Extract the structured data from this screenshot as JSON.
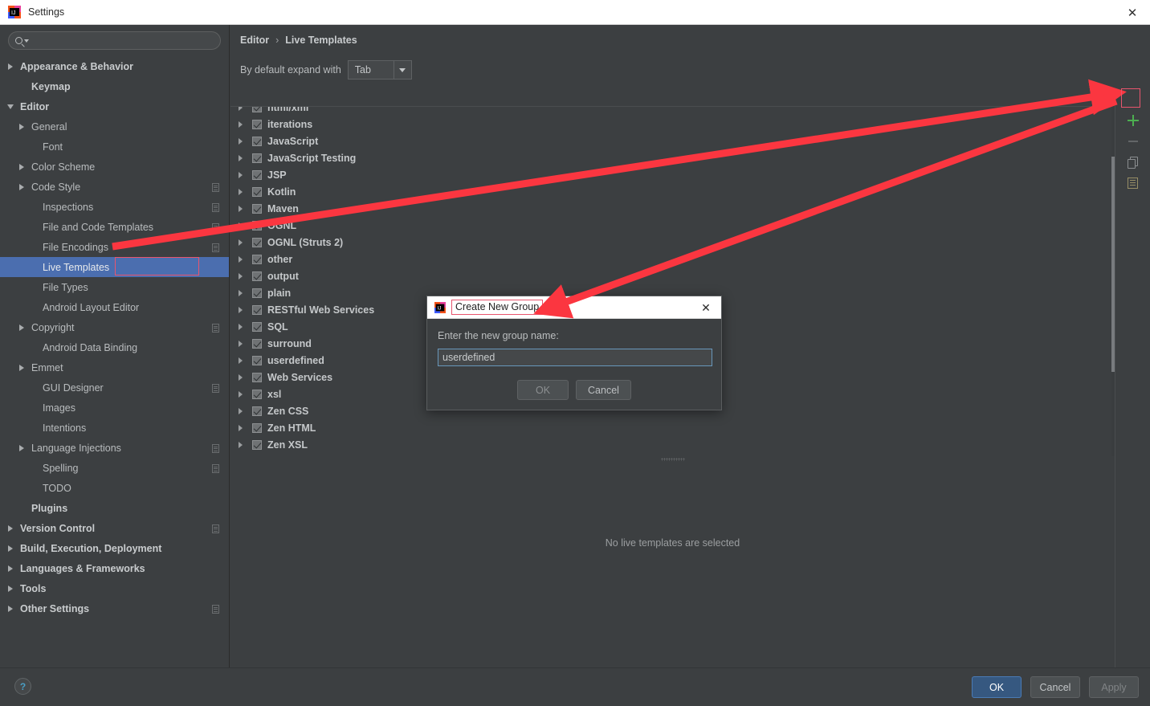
{
  "window": {
    "title": "Settings",
    "icon": "intellij-idea-icon",
    "close_label": "✕"
  },
  "sidebar": {
    "search": {
      "placeholder": "",
      "value": "",
      "icon": "search-icon"
    },
    "items": [
      {
        "label": "Appearance & Behavior",
        "arrow": "right",
        "indent": 0,
        "bold": true,
        "cfg": false,
        "selected": false
      },
      {
        "label": "Keymap",
        "arrow": "none",
        "indent": 1,
        "bold": true,
        "cfg": false,
        "selected": false
      },
      {
        "label": "Editor",
        "arrow": "down",
        "indent": 0,
        "bold": true,
        "cfg": false,
        "selected": false
      },
      {
        "label": "General",
        "arrow": "right",
        "indent": 1,
        "bold": false,
        "cfg": false,
        "selected": false
      },
      {
        "label": "Font",
        "arrow": "none",
        "indent": 2,
        "bold": false,
        "cfg": false,
        "selected": false
      },
      {
        "label": "Color Scheme",
        "arrow": "right",
        "indent": 1,
        "bold": false,
        "cfg": false,
        "selected": false
      },
      {
        "label": "Code Style",
        "arrow": "right",
        "indent": 1,
        "bold": false,
        "cfg": true,
        "selected": false
      },
      {
        "label": "Inspections",
        "arrow": "none",
        "indent": 2,
        "bold": false,
        "cfg": true,
        "selected": false
      },
      {
        "label": "File and Code Templates",
        "arrow": "none",
        "indent": 2,
        "bold": false,
        "cfg": true,
        "selected": false
      },
      {
        "label": "File Encodings",
        "arrow": "none",
        "indent": 2,
        "bold": false,
        "cfg": true,
        "selected": false
      },
      {
        "label": "Live Templates",
        "arrow": "none",
        "indent": 2,
        "bold": false,
        "cfg": false,
        "selected": true
      },
      {
        "label": "File Types",
        "arrow": "none",
        "indent": 2,
        "bold": false,
        "cfg": false,
        "selected": false
      },
      {
        "label": "Android Layout Editor",
        "arrow": "none",
        "indent": 2,
        "bold": false,
        "cfg": false,
        "selected": false
      },
      {
        "label": "Copyright",
        "arrow": "right",
        "indent": 1,
        "bold": false,
        "cfg": true,
        "selected": false
      },
      {
        "label": "Android Data Binding",
        "arrow": "none",
        "indent": 2,
        "bold": false,
        "cfg": false,
        "selected": false
      },
      {
        "label": "Emmet",
        "arrow": "right",
        "indent": 1,
        "bold": false,
        "cfg": false,
        "selected": false
      },
      {
        "label": "GUI Designer",
        "arrow": "none",
        "indent": 2,
        "bold": false,
        "cfg": true,
        "selected": false
      },
      {
        "label": "Images",
        "arrow": "none",
        "indent": 2,
        "bold": false,
        "cfg": false,
        "selected": false
      },
      {
        "label": "Intentions",
        "arrow": "none",
        "indent": 2,
        "bold": false,
        "cfg": false,
        "selected": false
      },
      {
        "label": "Language Injections",
        "arrow": "right",
        "indent": 1,
        "bold": false,
        "cfg": true,
        "selected": false
      },
      {
        "label": "Spelling",
        "arrow": "none",
        "indent": 2,
        "bold": false,
        "cfg": true,
        "selected": false
      },
      {
        "label": "TODO",
        "arrow": "none",
        "indent": 2,
        "bold": false,
        "cfg": false,
        "selected": false
      },
      {
        "label": "Plugins",
        "arrow": "none",
        "indent": 1,
        "bold": true,
        "cfg": false,
        "selected": false
      },
      {
        "label": "Version Control",
        "arrow": "right",
        "indent": 0,
        "bold": true,
        "cfg": true,
        "selected": false
      },
      {
        "label": "Build, Execution, Deployment",
        "arrow": "right",
        "indent": 0,
        "bold": true,
        "cfg": false,
        "selected": false
      },
      {
        "label": "Languages & Frameworks",
        "arrow": "right",
        "indent": 0,
        "bold": true,
        "cfg": false,
        "selected": false
      },
      {
        "label": "Tools",
        "arrow": "right",
        "indent": 0,
        "bold": true,
        "cfg": false,
        "selected": false
      },
      {
        "label": "Other Settings",
        "arrow": "right",
        "indent": 0,
        "bold": true,
        "cfg": true,
        "selected": false
      }
    ]
  },
  "main": {
    "breadcrumb": {
      "parent": "Editor",
      "separator": "›",
      "current": "Live Templates"
    },
    "expand_with": {
      "label": "By default expand with",
      "value": "Tab"
    },
    "template_groups": [
      {
        "label": "html/xml",
        "checked": true
      },
      {
        "label": "iterations",
        "checked": true
      },
      {
        "label": "JavaScript",
        "checked": true
      },
      {
        "label": "JavaScript Testing",
        "checked": true
      },
      {
        "label": "JSP",
        "checked": true
      },
      {
        "label": "Kotlin",
        "checked": true
      },
      {
        "label": "Maven",
        "checked": true
      },
      {
        "label": "OGNL",
        "checked": true
      },
      {
        "label": "OGNL (Struts 2)",
        "checked": true
      },
      {
        "label": "other",
        "checked": true
      },
      {
        "label": "output",
        "checked": true
      },
      {
        "label": "plain",
        "checked": true
      },
      {
        "label": "RESTful Web Services",
        "checked": true
      },
      {
        "label": "SQL",
        "checked": true
      },
      {
        "label": "surround",
        "checked": true
      },
      {
        "label": "userdefined",
        "checked": true
      },
      {
        "label": "Web Services",
        "checked": true
      },
      {
        "label": "xsl",
        "checked": true
      },
      {
        "label": "Zen CSS",
        "checked": true
      },
      {
        "label": "Zen HTML",
        "checked": true
      },
      {
        "label": "Zen XSL",
        "checked": true
      }
    ],
    "empty_message": "No live templates are selected",
    "toolbar": [
      {
        "name": "add-button",
        "icon": "plus-icon",
        "enabled": true
      },
      {
        "name": "remove-button",
        "icon": "minus-icon",
        "enabled": false
      },
      {
        "name": "duplicate-button",
        "icon": "copy-icon",
        "enabled": true
      },
      {
        "name": "restore-defaults-button",
        "icon": "list-icon",
        "enabled": true
      }
    ]
  },
  "dialog": {
    "title": "Create New Group",
    "icon": "intellij-idea-icon",
    "close_label": "✕",
    "label": "Enter the new group name:",
    "input_value": "userdefined",
    "input_placeholder": "",
    "ok_label": "OK",
    "cancel_label": "Cancel"
  },
  "footer": {
    "help_label": "?",
    "ok_label": "OK",
    "cancel_label": "Cancel",
    "apply_label": "Apply"
  },
  "colors": {
    "background": "#3c3f41",
    "selection": "#4b6eaf",
    "annotation": "#fb3640",
    "annotation_box": "#e8556e",
    "primary_button": "#365880",
    "add_icon_green": "#4caf50"
  }
}
